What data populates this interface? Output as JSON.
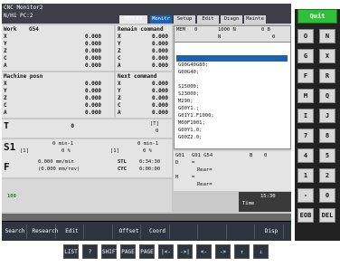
{
  "title": {
    "line1": "CNC Monitor2",
    "line2": "N/H1 PC:2"
  },
  "tabs": {
    "memory": "MEMORY",
    "active": "Monitr",
    "t2": "Setup",
    "t3": "Edit",
    "t4": "Diagn",
    "t5": "Mainte"
  },
  "exit_label": "Quit",
  "work": {
    "title": "Work",
    "num": "G54",
    "rows": [
      {
        "a": "X",
        "v": "0.000"
      },
      {
        "a": "Y",
        "v": "0.000"
      },
      {
        "a": "Z",
        "v": "0.000"
      },
      {
        "a": "C",
        "v": "0.000"
      },
      {
        "a": "A",
        "v": "0.000"
      }
    ]
  },
  "remain": {
    "title": "Remain command",
    "rows": [
      {
        "a": "X",
        "v": "0.000"
      },
      {
        "a": "Y",
        "v": "0.000"
      },
      {
        "a": "Z",
        "v": "0.000"
      },
      {
        "a": "C",
        "v": "0.000"
      },
      {
        "a": "A",
        "v": "0.000"
      }
    ]
  },
  "machine": {
    "title": "Machine posn",
    "rows": [
      {
        "a": "X",
        "v": "0.000"
      },
      {
        "a": "Y",
        "v": "0.000"
      },
      {
        "a": "Z",
        "v": "0.000"
      },
      {
        "a": "C",
        "v": "0.000"
      },
      {
        "a": "A",
        "v": "0.000"
      }
    ]
  },
  "next": {
    "title": "Next command",
    "rows": [
      {
        "a": "X",
        "v": "0.000"
      },
      {
        "a": "Y",
        "v": "0.000"
      },
      {
        "a": "Z",
        "v": "0.000"
      },
      {
        "a": "C",
        "v": "0.000"
      },
      {
        "a": "A",
        "v": "0.000"
      }
    ]
  },
  "program": {
    "mem": "MEM",
    "o": "0",
    "n": "1000 N",
    "b": "0 B",
    "nval": "N",
    "zero": "0",
    "lines": [
      "G90G40G80;",
      "G00G40;",
      "",
      "S15000;",
      "S23000;",
      "M290;",
      "G00Y1.;",
      "G01Y1.F1000;",
      "M00F1001;",
      "G00Y1.0;",
      "G00Z2.0;"
    ]
  },
  "t": {
    "label": "T",
    "value": "0",
    "t_right": "[T]",
    "t_right_val": "0"
  },
  "s1": {
    "label": "S1",
    "rate": "0 min-1",
    "br": "[1]",
    "pct": "0 %",
    "rmin": "0 min-1",
    "r1": "[1]",
    "r2": "0 %"
  },
  "feed": {
    "label": "F",
    "f1": "0.000 mm/min",
    "f2": "(0.000 mm/rev)",
    "stl_l": "STL",
    "stl_v": "0:34:30",
    "cyc_l": "CYC",
    "cyc_v": "0:00:00"
  },
  "mod": {
    "g01": "G01",
    "g91": "G91 G54",
    "b": "B",
    "bval": "0",
    "h_l": "H",
    "h_v": "=",
    "d_l": "D",
    "d_v": "=",
    "rear1": "Rear=",
    "rear2": "Rear="
  },
  "override": {
    "pct": "100"
  },
  "softkeys": [
    "Search",
    "Research",
    "Edit",
    "",
    "Offset",
    "Coord",
    "",
    "",
    "",
    "Disp sw."
  ],
  "clock": {
    "time": "15:30",
    "label": "Time"
  },
  "keypad": [
    {
      "l": "O",
      "r": "N"
    },
    {
      "l": "G",
      "r": "X"
    },
    {
      "l": "F",
      "r": "R"
    },
    {
      "l": "M",
      "r": "Q"
    },
    {
      "l": "I",
      "r": "J"
    },
    {
      "l": "7",
      "r": "8"
    },
    {
      "l": "4",
      "r": "5"
    },
    {
      "l": "1",
      "r": "2"
    },
    {
      "l": "-",
      "r": "0"
    },
    {
      "l": "EOB",
      "r": "DEL"
    }
  ],
  "bottom_keys": [
    "LIST",
    "?",
    "SHIFT",
    "PAGE",
    "PAGE",
    "|<-",
    "->|",
    "<-",
    "->",
    "↑",
    "↓"
  ]
}
